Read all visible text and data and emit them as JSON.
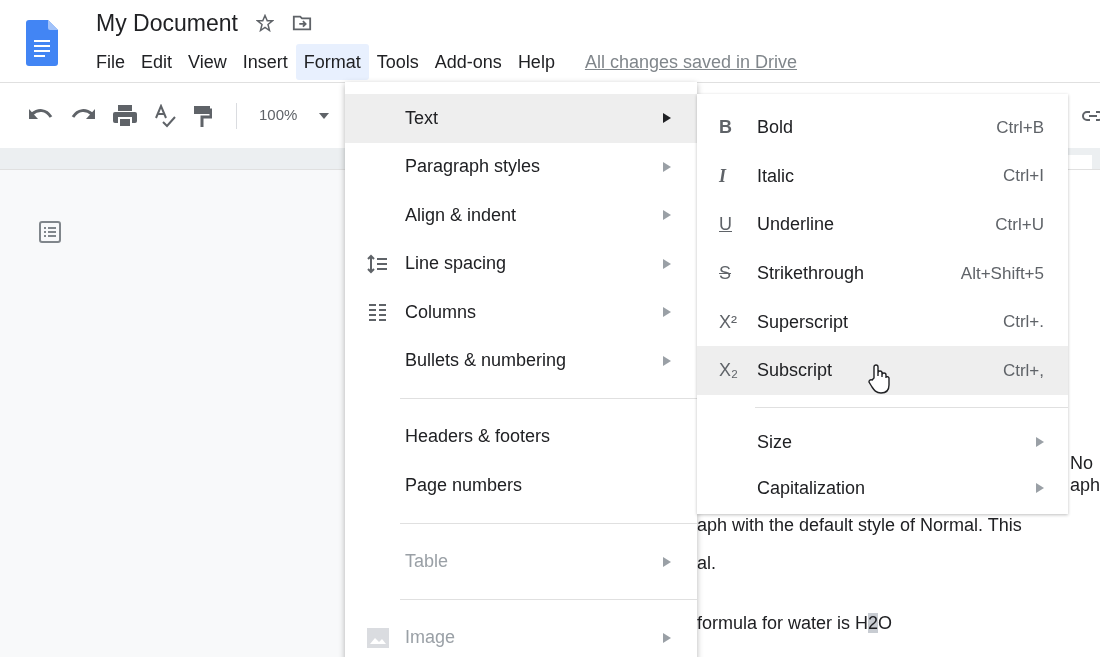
{
  "title": "My Document",
  "starred": false,
  "menu_bar": [
    {
      "label": "File",
      "selected": false
    },
    {
      "label": "Edit",
      "selected": false
    },
    {
      "label": "View",
      "selected": false
    },
    {
      "label": "Insert",
      "selected": false
    },
    {
      "label": "Format",
      "selected": true
    },
    {
      "label": "Tools",
      "selected": false
    },
    {
      "label": "Add-ons",
      "selected": false
    },
    {
      "label": "Help",
      "selected": false
    }
  ],
  "save_status": "All changes saved in Drive",
  "toolbar": {
    "zoom": "100%"
  },
  "format_menu": [
    {
      "kind": "plain",
      "label": "Text",
      "submenu": true,
      "selected": true,
      "disabled": false
    },
    {
      "kind": "plain",
      "label": "Paragraph styles",
      "submenu": true,
      "selected": false,
      "disabled": false
    },
    {
      "kind": "plain",
      "label": "Align & indent",
      "submenu": true,
      "selected": false,
      "disabled": false
    },
    {
      "kind": "spacing",
      "label": "Line spacing",
      "submenu": true,
      "selected": false,
      "disabled": false
    },
    {
      "kind": "columns",
      "label": "Columns",
      "submenu": true,
      "selected": false,
      "disabled": false
    },
    {
      "kind": "plain",
      "label": "Bullets & numbering",
      "submenu": true,
      "selected": false,
      "disabled": false
    },
    {
      "kind": "separator"
    },
    {
      "kind": "plain",
      "label": "Headers & footers",
      "submenu": false,
      "selected": false,
      "disabled": false
    },
    {
      "kind": "plain",
      "label": "Page numbers",
      "submenu": false,
      "selected": false,
      "disabled": false
    },
    {
      "kind": "separator"
    },
    {
      "kind": "plain",
      "label": "Table",
      "submenu": true,
      "selected": false,
      "disabled": true
    },
    {
      "kind": "separator"
    },
    {
      "kind": "image",
      "label": "Image",
      "submenu": true,
      "selected": false,
      "disabled": true
    }
  ],
  "text_submenu": [
    {
      "kind": "bold",
      "glyph": "B",
      "label": "Bold",
      "shortcut": "Ctrl+B",
      "selected": false
    },
    {
      "kind": "italic",
      "glyph": "I",
      "label": "Italic",
      "shortcut": "Ctrl+I",
      "selected": false
    },
    {
      "kind": "underline",
      "glyph": "U",
      "label": "Underline",
      "shortcut": "Ctrl+U",
      "selected": false
    },
    {
      "kind": "strike",
      "glyph": "S",
      "label": "Strikethrough",
      "shortcut": "Alt+Shift+5",
      "selected": false
    },
    {
      "kind": "script",
      "glyph": "X²",
      "label": "Superscript",
      "shortcut": "Ctrl+.",
      "selected": false
    },
    {
      "kind": "script",
      "glyph": "X₂",
      "label": "Subscript",
      "shortcut": "Ctrl+,",
      "selected": true
    },
    {
      "kind": "separator"
    },
    {
      "kind": "plain",
      "label": "Size",
      "submenu": true,
      "selected": false
    },
    {
      "kind": "plain",
      "label": "Capitalization",
      "submenu": true,
      "selected": false
    }
  ],
  "document_lines": [
    {
      "kind": "right",
      "parts": [
        {
          "text": "No",
          "selected": false
        }
      ]
    },
    {
      "kind": "right",
      "parts": [
        {
          "text": "aph",
          "selected": false
        }
      ]
    },
    {
      "kind": "left",
      "parts": [
        {
          "text": "aph with the default style of Normal. This",
          "selected": false
        }
      ]
    },
    {
      "kind": "left",
      "parts": [
        {
          "text": "al.",
          "selected": false
        }
      ]
    },
    {
      "kind": "left",
      "parts": [
        {
          "text": "formula for water is H",
          "selected": false
        },
        {
          "text": "2",
          "selected": true
        },
        {
          "text": "O",
          "selected": false
        }
      ]
    }
  ]
}
